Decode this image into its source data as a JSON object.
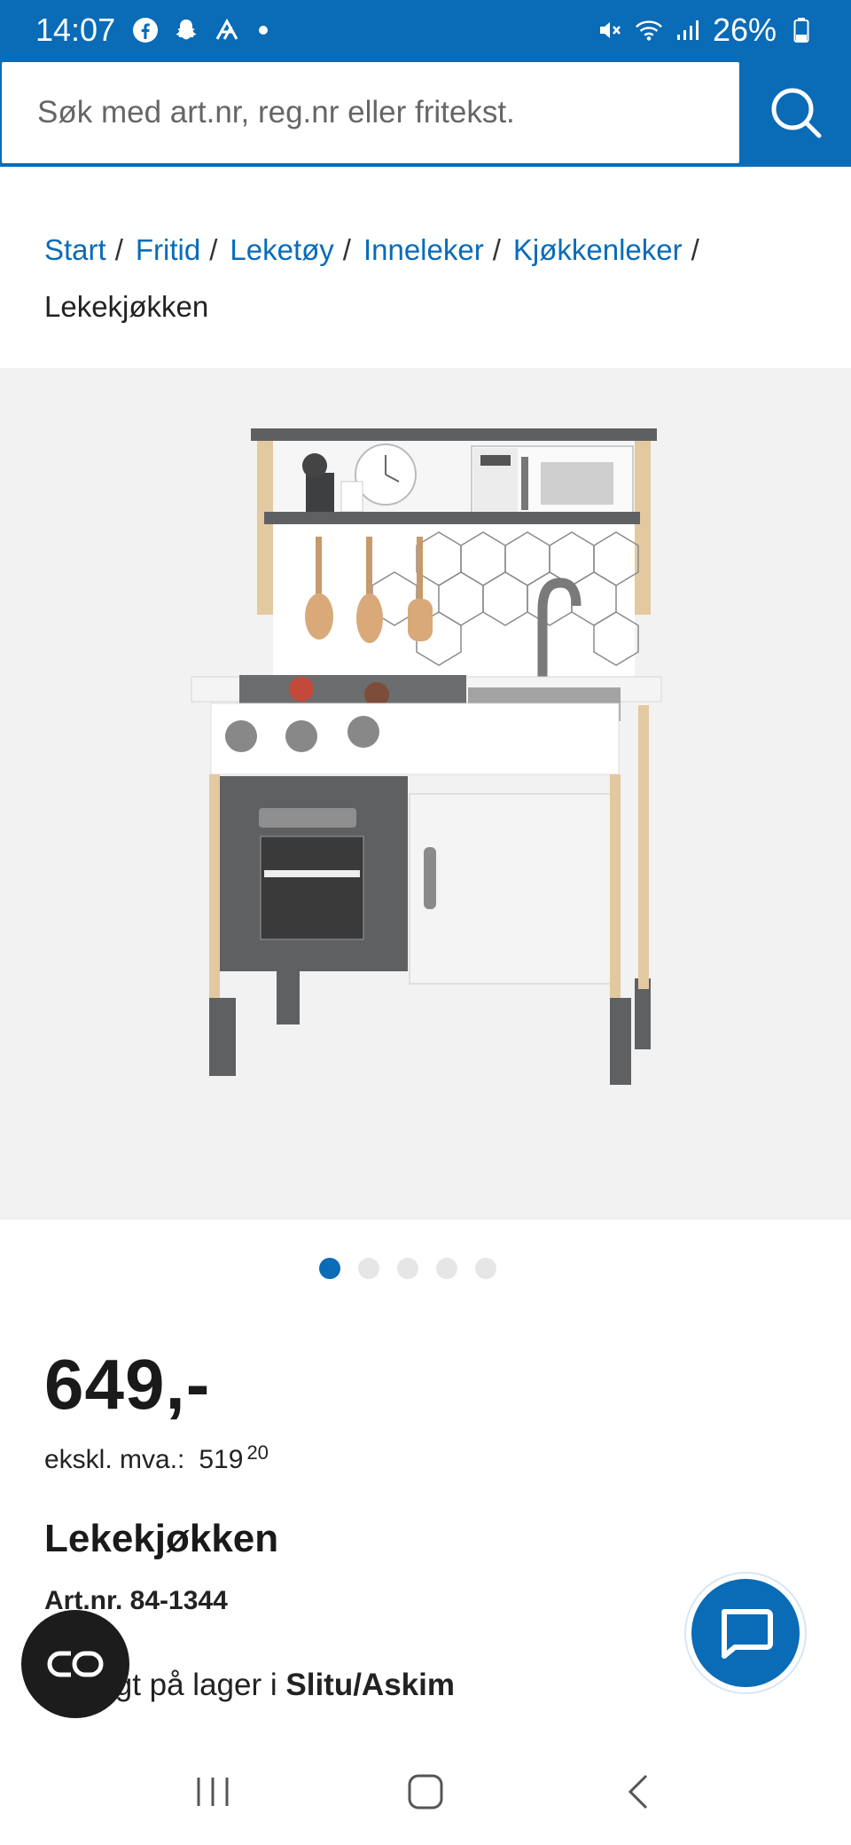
{
  "status": {
    "time": "14:07",
    "battery": "26%",
    "icons": [
      "facebook-icon",
      "snapchat-icon",
      "app-icon",
      "mute-icon",
      "wifi-icon",
      "signal-icon",
      "battery-icon"
    ]
  },
  "search": {
    "placeholder": "Søk med art.nr, reg.nr eller fritekst."
  },
  "breadcrumb": {
    "items": [
      "Start",
      "Fritid",
      "Leketøy",
      "Inneleker",
      "Kjøkkenleker"
    ],
    "current": "Lekekjøkken"
  },
  "carousel": {
    "count": 5,
    "active_index": 0
  },
  "product": {
    "price": "649,-",
    "ex_vat_label": "ekskl. mva.:",
    "ex_vat_whole": "519",
    "ex_vat_decimals": "20",
    "title": "Lekekjøkken",
    "article_no": "Art.nr. 84-1344",
    "stock_text": "Utsolgt på lager i",
    "stock_store": "Slitu/Askim"
  },
  "colors": {
    "brand_blue": "#0a6bb7",
    "image_bg": "#f2f2f2"
  }
}
